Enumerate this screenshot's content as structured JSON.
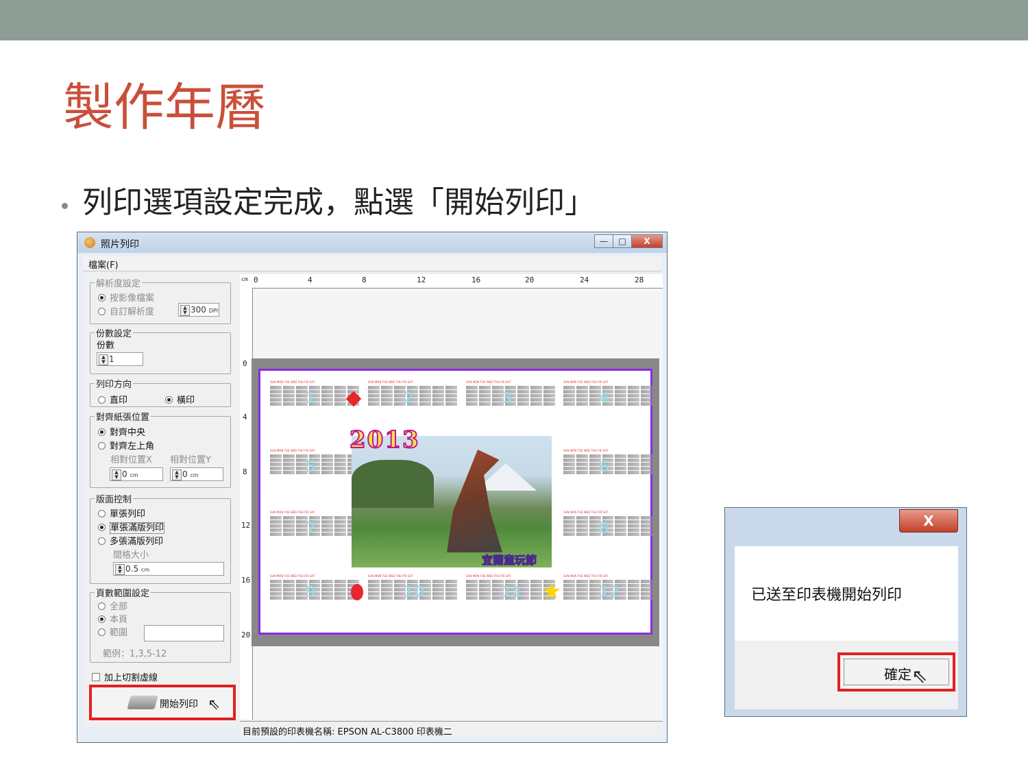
{
  "slide": {
    "title": "製作年曆",
    "bullet": "列印選項設定完成，點選「開始列印」"
  },
  "print_window": {
    "title": "照片列印",
    "controls": {
      "minimize": "—",
      "maximize": "□",
      "close": "X"
    },
    "menu": {
      "file": "檔案(F)"
    },
    "resolution": {
      "legend": "解析度設定",
      "by_image": "按影像檔案",
      "custom": "自訂解析度",
      "dpi_value": "300",
      "dpi_unit": "DPI"
    },
    "copies": {
      "legend": "份數設定",
      "label": "份數",
      "value": "1"
    },
    "orientation": {
      "legend": "列印方向",
      "portrait": "直印",
      "landscape": "橫印"
    },
    "alignment": {
      "legend": "對齊紙張位置",
      "center": "對齊中央",
      "top_left": "對齊左上角",
      "rel_x": "相對位置X",
      "rel_y": "相對位置Y",
      "x_value": "0",
      "y_value": "0",
      "unit": "cm"
    },
    "layout": {
      "legend": "版面控制",
      "single": "單張列印",
      "single_full": "單張滿版列印",
      "multi_full": "多張滿版列印",
      "gap_label": "間格大小",
      "gap_value": "0.5",
      "gap_unit": "cm"
    },
    "pages": {
      "legend": "頁數範圍設定",
      "all": "全部",
      "current": "本頁",
      "range": "範圍",
      "example": "範例：1,3,5-12"
    },
    "cut_lines": "加上切割虛線",
    "start_print": "開始列印",
    "ruler_unit": "cm",
    "ruler_h": [
      "0",
      "4",
      "8",
      "12",
      "16",
      "20",
      "24",
      "28"
    ],
    "ruler_v": [
      "0",
      "4",
      "8",
      "12",
      "16",
      "20"
    ],
    "status": "目前預設的印表機名稱: EPSON AL-C3800 印表機二"
  },
  "calendar_preview": {
    "year": "2013",
    "watermark": "宜蘭童玩節",
    "weekday_header": "SUN MON TUE WED THU FRI SAT",
    "months": [
      "1",
      "2",
      "3",
      "4",
      "5",
      "6",
      "7",
      "8",
      "9",
      "10",
      "11",
      "12"
    ]
  },
  "confirm_dialog": {
    "close": "X",
    "message": "已送至印表機開始列印",
    "ok": "確定"
  },
  "colors": {
    "top_bar": "#8e9e97",
    "title": "#c8503a",
    "highlight": "#e02020",
    "page_border": "#8a2be2"
  }
}
